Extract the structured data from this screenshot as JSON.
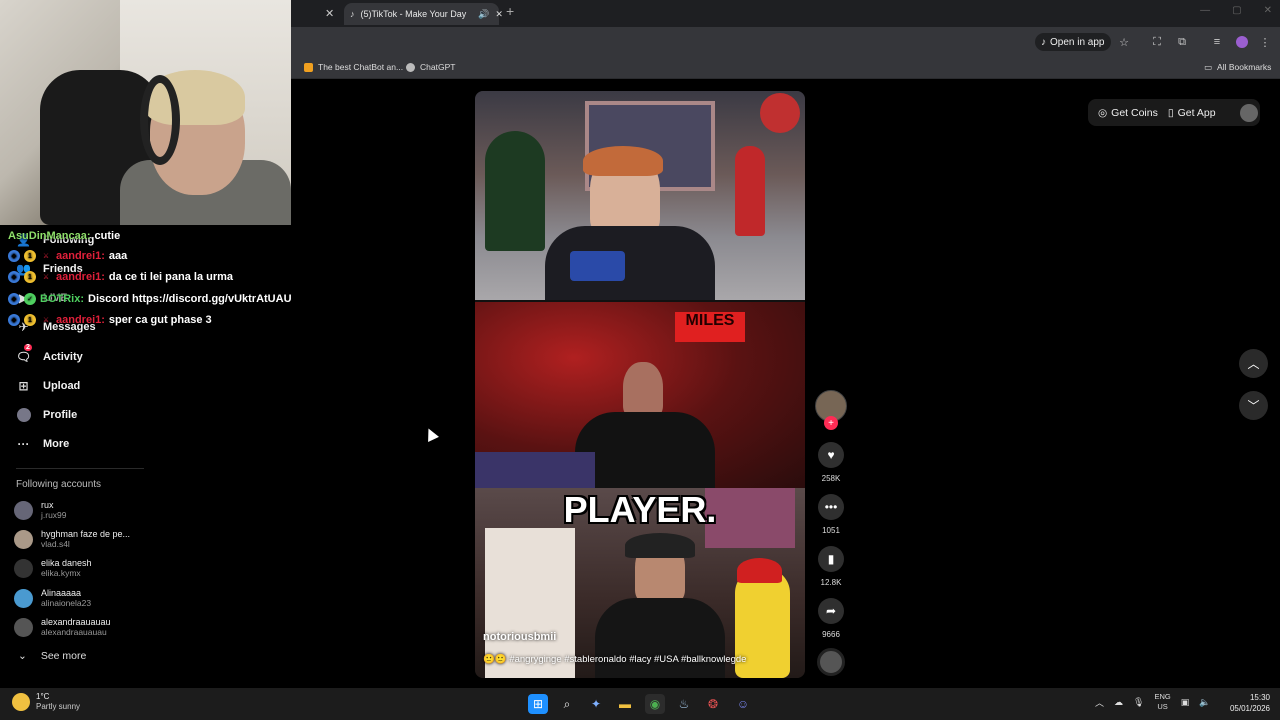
{
  "browser": {
    "tabs": [
      {
        "label": "",
        "closable": true
      },
      {
        "label": "(5)TikTok - Make Your Day",
        "active": true
      }
    ],
    "new_tab": "+",
    "open_in_app": "Open in app",
    "bookmarks": [
      {
        "label": "The best ChatBot an...",
        "icon": "chatbot-icon"
      },
      {
        "label": "ChatGPT",
        "icon": "chatgpt-icon"
      }
    ],
    "all_bookmarks": "All Bookmarks"
  },
  "chat": [
    {
      "user": "AsuDinMancaa:",
      "user_color": "#8fe06a",
      "text": "cutie"
    },
    {
      "user": "aandrei1:",
      "user_color": "#e0203a",
      "text": "aaa"
    },
    {
      "user": "aandrei1:",
      "user_color": "#e0203a",
      "text": "da ce ti lei pana la urma"
    },
    {
      "user": "BOTRix:",
      "user_color": "#4fd060",
      "text": "Discord https://discord.gg/vUktrAtUAU"
    },
    {
      "user": "aandrei1:",
      "user_color": "#e0203a",
      "text": "sper ca gut phase 3"
    }
  ],
  "sidebar": {
    "items": [
      {
        "label": "Following",
        "icon": "following-icon"
      },
      {
        "label": "Friends",
        "icon": "friends-icon"
      },
      {
        "label": "LIVE",
        "icon": "live-icon"
      },
      {
        "label": "Messages",
        "icon": "messages-icon"
      },
      {
        "label": "Activity",
        "icon": "activity-icon",
        "badge": "2"
      },
      {
        "label": "Upload",
        "icon": "upload-icon"
      },
      {
        "label": "Profile",
        "icon": "profile-icon"
      },
      {
        "label": "More",
        "icon": "more-icon"
      }
    ],
    "following_title": "Following accounts",
    "accounts": [
      {
        "name": "rux",
        "handle": "j.rux99"
      },
      {
        "name": "hyghman faze de pe...",
        "handle": "vlad.s4l"
      },
      {
        "name": "elika danesh",
        "handle": "elika.kymx"
      },
      {
        "name": "Alinaaaaa",
        "handle": "alinaionela23"
      },
      {
        "name": "alexandraauauau",
        "handle": "alexandraauauau"
      }
    ],
    "see_more": "See more"
  },
  "topright": {
    "get_coins": "Get Coins",
    "get_app": "Get App"
  },
  "video": {
    "overlay_text": "PLAYER.",
    "author": "notoriousbmii",
    "caption": "#angryginge #stableronaldo #lacy #USA #ballknowlegde"
  },
  "actions": {
    "likes": "258K",
    "comments": "1051",
    "saves": "12.8K",
    "shares": "9666"
  },
  "taskbar": {
    "temp": "1°C",
    "weather": "Partly sunny",
    "lang1": "ENG",
    "lang2": "US",
    "time": "15:30",
    "date": "05/01/2026"
  }
}
